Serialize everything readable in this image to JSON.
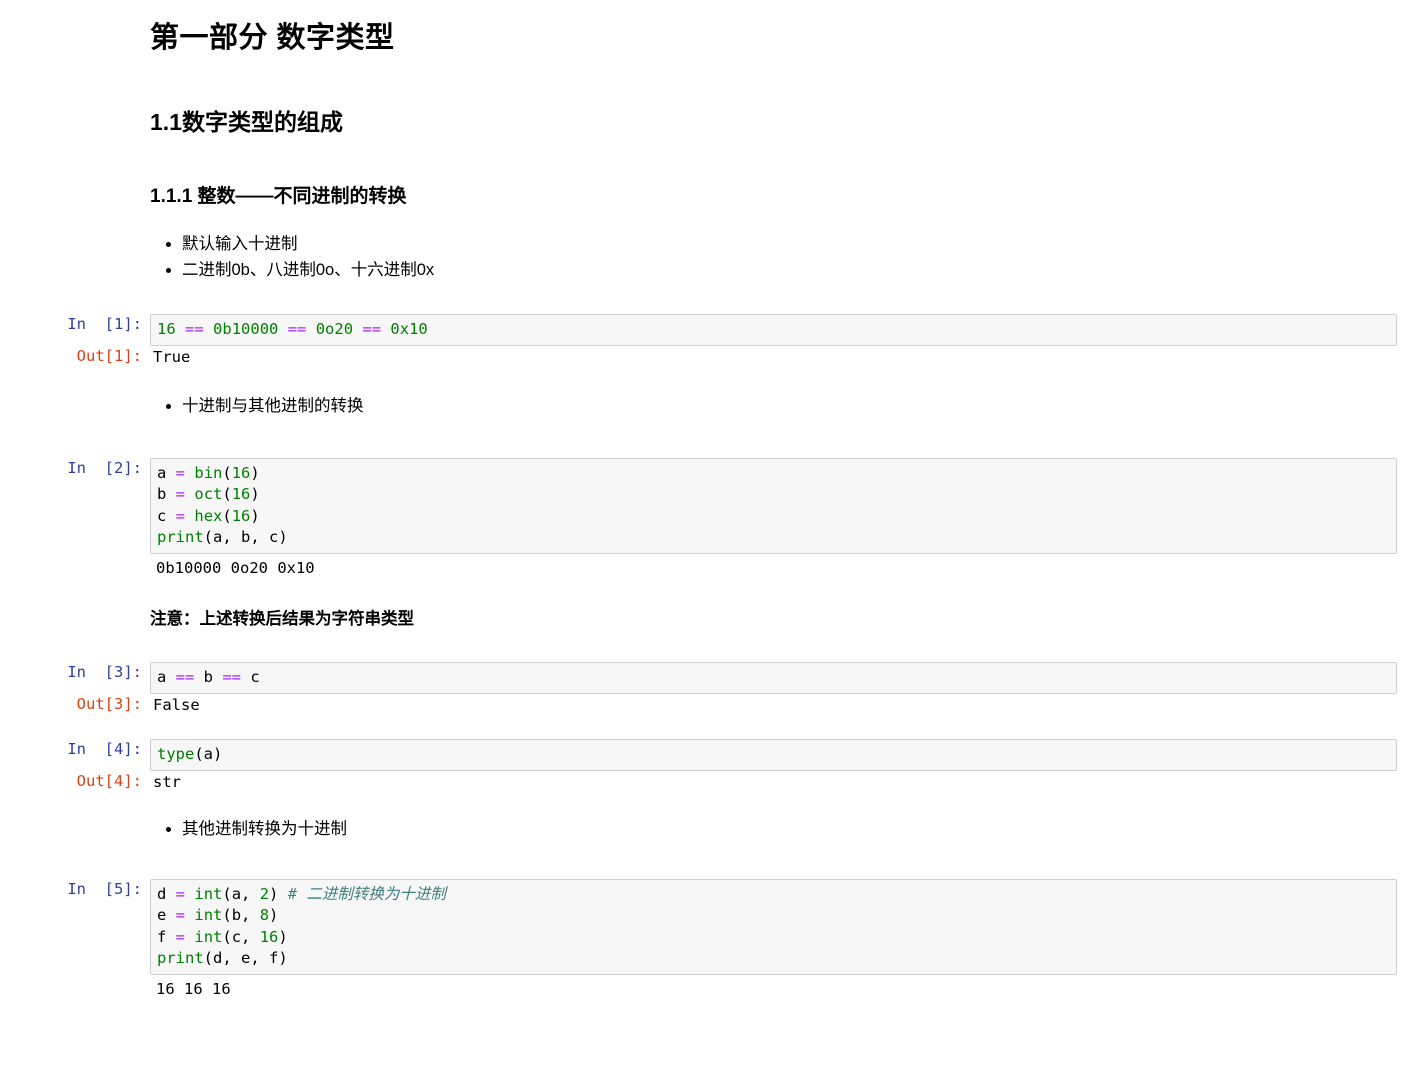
{
  "headings": {
    "h1": "第一部分 数字类型",
    "h2": "1.1数字类型的组成",
    "h3": "1.1.1 整数——不同进制的转换"
  },
  "lists": {
    "first": [
      "默认输入十进制",
      "二进制0b、八进制0o、十六进制0x"
    ],
    "second": [
      "十进制与其他进制的转换"
    ],
    "third": [
      "其他进制转换为十进制"
    ]
  },
  "notes": {
    "string_type": "注意：上述转换后结果为字符串类型"
  },
  "cells": [
    {
      "prompt_in": "In  [1]:",
      "prompt_out": "Out[1]:",
      "code_tokens": [
        {
          "t": "16",
          "c": "tok-num"
        },
        {
          "t": " ",
          "c": "tok-nm"
        },
        {
          "t": "==",
          "c": "tok-op"
        },
        {
          "t": " ",
          "c": "tok-nm"
        },
        {
          "t": "0b10000",
          "c": "tok-num"
        },
        {
          "t": " ",
          "c": "tok-nm"
        },
        {
          "t": "==",
          "c": "tok-op"
        },
        {
          "t": " ",
          "c": "tok-nm"
        },
        {
          "t": "0o20",
          "c": "tok-num"
        },
        {
          "t": " ",
          "c": "tok-nm"
        },
        {
          "t": "==",
          "c": "tok-op"
        },
        {
          "t": " ",
          "c": "tok-nm"
        },
        {
          "t": "0x10",
          "c": "tok-num"
        }
      ],
      "output": "True"
    },
    {
      "prompt_in": "In  [2]:",
      "code_tokens": [
        {
          "t": "a ",
          "c": "tok-nm"
        },
        {
          "t": "=",
          "c": "tok-op"
        },
        {
          "t": " ",
          "c": "tok-nm"
        },
        {
          "t": "bin",
          "c": "tok-bi"
        },
        {
          "t": "(",
          "c": "tok-nm"
        },
        {
          "t": "16",
          "c": "tok-num"
        },
        {
          "t": ")\n",
          "c": "tok-nm"
        },
        {
          "t": "b ",
          "c": "tok-nm"
        },
        {
          "t": "=",
          "c": "tok-op"
        },
        {
          "t": " ",
          "c": "tok-nm"
        },
        {
          "t": "oct",
          "c": "tok-bi"
        },
        {
          "t": "(",
          "c": "tok-nm"
        },
        {
          "t": "16",
          "c": "tok-num"
        },
        {
          "t": ")\n",
          "c": "tok-nm"
        },
        {
          "t": "c ",
          "c": "tok-nm"
        },
        {
          "t": "=",
          "c": "tok-op"
        },
        {
          "t": " ",
          "c": "tok-nm"
        },
        {
          "t": "hex",
          "c": "tok-bi"
        },
        {
          "t": "(",
          "c": "tok-nm"
        },
        {
          "t": "16",
          "c": "tok-num"
        },
        {
          "t": ")\n",
          "c": "tok-nm"
        },
        {
          "t": "print",
          "c": "tok-bi"
        },
        {
          "t": "(a, b, c)",
          "c": "tok-nm"
        }
      ],
      "stream": "0b10000 0o20 0x10"
    },
    {
      "prompt_in": "In  [3]:",
      "prompt_out": "Out[3]:",
      "code_tokens": [
        {
          "t": "a ",
          "c": "tok-nm"
        },
        {
          "t": "==",
          "c": "tok-op"
        },
        {
          "t": " b ",
          "c": "tok-nm"
        },
        {
          "t": "==",
          "c": "tok-op"
        },
        {
          "t": " c",
          "c": "tok-nm"
        }
      ],
      "output": "False"
    },
    {
      "prompt_in": "In  [4]:",
      "prompt_out": "Out[4]:",
      "code_tokens": [
        {
          "t": "type",
          "c": "tok-bi"
        },
        {
          "t": "(a)",
          "c": "tok-nm"
        }
      ],
      "output": "str"
    },
    {
      "prompt_in": "In  [5]:",
      "code_tokens": [
        {
          "t": "d ",
          "c": "tok-nm"
        },
        {
          "t": "=",
          "c": "tok-op"
        },
        {
          "t": " ",
          "c": "tok-nm"
        },
        {
          "t": "int",
          "c": "tok-bi"
        },
        {
          "t": "(a, ",
          "c": "tok-nm"
        },
        {
          "t": "2",
          "c": "tok-num"
        },
        {
          "t": ") ",
          "c": "tok-nm"
        },
        {
          "t": "# 二进制转换为十进制",
          "c": "tok-cm"
        },
        {
          "t": "\n",
          "c": "tok-nm"
        },
        {
          "t": "e ",
          "c": "tok-nm"
        },
        {
          "t": "=",
          "c": "tok-op"
        },
        {
          "t": " ",
          "c": "tok-nm"
        },
        {
          "t": "int",
          "c": "tok-bi"
        },
        {
          "t": "(b, ",
          "c": "tok-nm"
        },
        {
          "t": "8",
          "c": "tok-num"
        },
        {
          "t": ")\n",
          "c": "tok-nm"
        },
        {
          "t": "f ",
          "c": "tok-nm"
        },
        {
          "t": "=",
          "c": "tok-op"
        },
        {
          "t": " ",
          "c": "tok-nm"
        },
        {
          "t": "int",
          "c": "tok-bi"
        },
        {
          "t": "(c, ",
          "c": "tok-nm"
        },
        {
          "t": "16",
          "c": "tok-num"
        },
        {
          "t": ")\n",
          "c": "tok-nm"
        },
        {
          "t": "print",
          "c": "tok-bi"
        },
        {
          "t": "(d, e, f)",
          "c": "tok-nm"
        }
      ],
      "stream": "16 16 16"
    }
  ],
  "colors": {
    "prompt_in": "#303f9f",
    "prompt_out": "#d84315",
    "code_bg": "#f7f7f7",
    "code_border": "#cfcfcf",
    "operator": "#aa22ff",
    "number": "#008000",
    "builtin": "#008000",
    "comment": "#408080"
  }
}
